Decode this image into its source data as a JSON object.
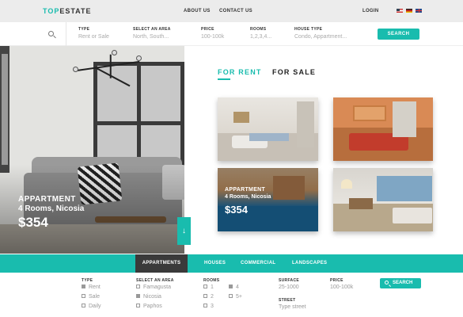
{
  "logo": {
    "part1": "TOP",
    "part2": "ESTATE"
  },
  "nav": {
    "about": "ABOUT US",
    "contact": "CONTACT US",
    "login": "LOGIN"
  },
  "languages": [
    "us-flag",
    "de-flag",
    "uk-flag"
  ],
  "search": {
    "fields": [
      {
        "label": "TYPE",
        "value": "Rent or Sale"
      },
      {
        "label": "SELECT AN AREA",
        "value": "North, South..."
      },
      {
        "label": "PRICE",
        "value": "100-100k"
      },
      {
        "label": "ROOMS",
        "value": "1,2,3,4..."
      },
      {
        "label": "HOUSE TYPE",
        "value": "Condo, Appartment..."
      }
    ],
    "button": "SEARCH"
  },
  "hero": {
    "title": "APPARTMENT",
    "subtitle": "4 Rooms, Nicosia",
    "price": "$354",
    "arrow": "↓"
  },
  "tabs": {
    "rent": "FOR RENT",
    "sale": "FOR SALE"
  },
  "featured": {
    "title": "APPARTMENT",
    "subtitle": "4 Rooms, Nicosia",
    "price": "$354"
  },
  "categories": {
    "items": [
      "APPARTMENTS",
      "HOUSES",
      "COMMERCIAL",
      "LANDSCAPES"
    ],
    "active": "APPARTMENTS"
  },
  "filters": {
    "type": {
      "label": "TYPE",
      "options": [
        "Rent",
        "Sale",
        "Daily"
      ]
    },
    "area": {
      "label": "SELECT AN AREA",
      "options": [
        "Famagusta",
        "Nicosia",
        "Paphos"
      ]
    },
    "rooms": {
      "label": "ROOMS",
      "options": [
        "1",
        "2",
        "3",
        "4",
        "5+"
      ]
    },
    "surface": {
      "label": "SURFACE",
      "value": "25-1000"
    },
    "street": {
      "label": "STREET",
      "placeholder": "Type street"
    },
    "price": {
      "label": "PRICE",
      "value": "100-100k"
    },
    "button": "SEARCH"
  },
  "colors": {
    "accent": "#19bcae",
    "dark": "#3a3a3a"
  }
}
